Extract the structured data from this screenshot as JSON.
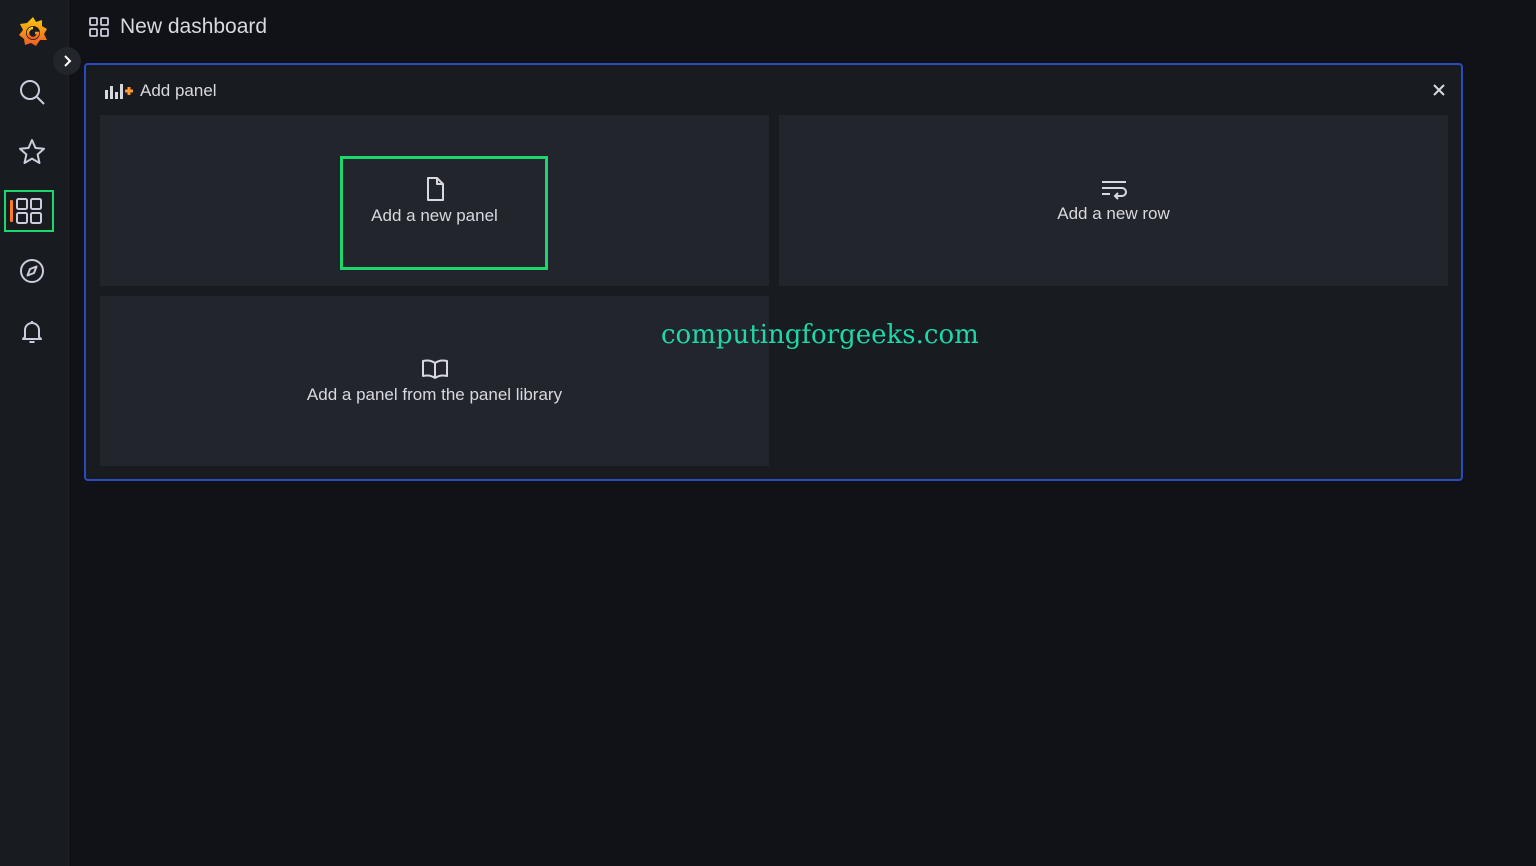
{
  "topbar": {
    "title": "New dashboard",
    "icon": "dashboard-grid-icon"
  },
  "sidebar": {
    "items": [
      {
        "name": "search",
        "icon": "search-icon"
      },
      {
        "name": "starred",
        "icon": "star-icon"
      },
      {
        "name": "dashboards",
        "icon": "dashboards-icon",
        "active": true
      },
      {
        "name": "explore",
        "icon": "compass-icon"
      },
      {
        "name": "alerting",
        "icon": "bell-icon"
      }
    ],
    "expand_icon": "chevron-right-icon"
  },
  "add_panel": {
    "header_label": "Add panel",
    "close_icon": "close-icon",
    "options": [
      {
        "label": "Add a new panel",
        "icon": "file-icon"
      },
      {
        "label": "Add a new row",
        "icon": "row-wrap-icon"
      },
      {
        "label": "Add a panel from the panel library",
        "icon": "book-icon"
      }
    ]
  },
  "watermark": "computingforgeeks.com",
  "colors": {
    "background": "#111217",
    "sidebar": "#181b1f",
    "card": "#22252b",
    "frame_border": "#2a4bbd",
    "highlight": "#1bd76c",
    "accent": "#ff7a22",
    "watermark": "#1dd8a7"
  }
}
